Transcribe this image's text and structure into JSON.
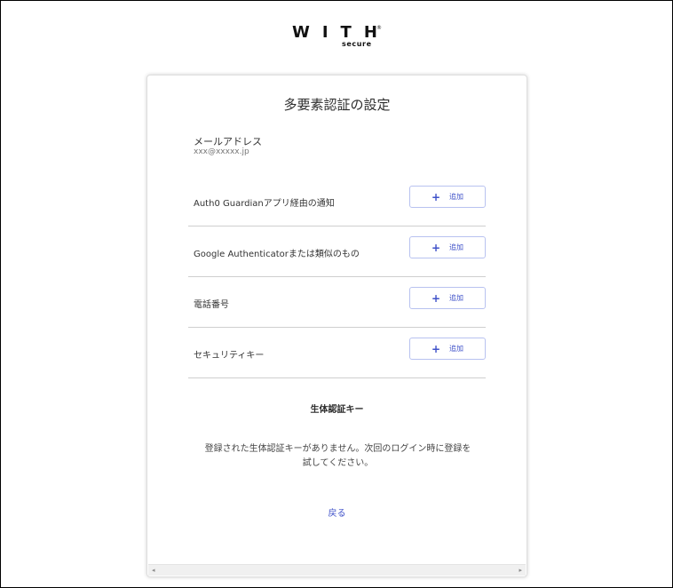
{
  "logo": {
    "main": "WITH",
    "registered": "®",
    "sub": "secure"
  },
  "card": {
    "title": "多要素認証の設定",
    "email_label": "メールアドレス",
    "email_value": "xxx@xxxxx.jp",
    "methods": [
      {
        "label": "Auth0 Guardianアプリ経由の通知",
        "button_label": "追加",
        "button_icon": "plus-icon"
      },
      {
        "label": "Google Authenticatorまたは類似のもの",
        "button_label": "追加",
        "button_icon": "plus-icon"
      },
      {
        "label": "電話番号",
        "button_label": "追加",
        "button_icon": "plus-icon"
      },
      {
        "label": "セキュリティキー",
        "button_label": "追加",
        "button_icon": "plus-icon"
      }
    ],
    "biometric_title": "生体認証キー",
    "biometric_message": "登録された生体認証キーがありません。次回のログイン時に登録を試してください。",
    "back_link": "戻る"
  },
  "scrollbar": {
    "left_arrow": "◂",
    "right_arrow": "▸"
  },
  "colors": {
    "accent": "#3f51c9",
    "button_border": "#b8c2f0",
    "divider": "#cfcfcf"
  }
}
